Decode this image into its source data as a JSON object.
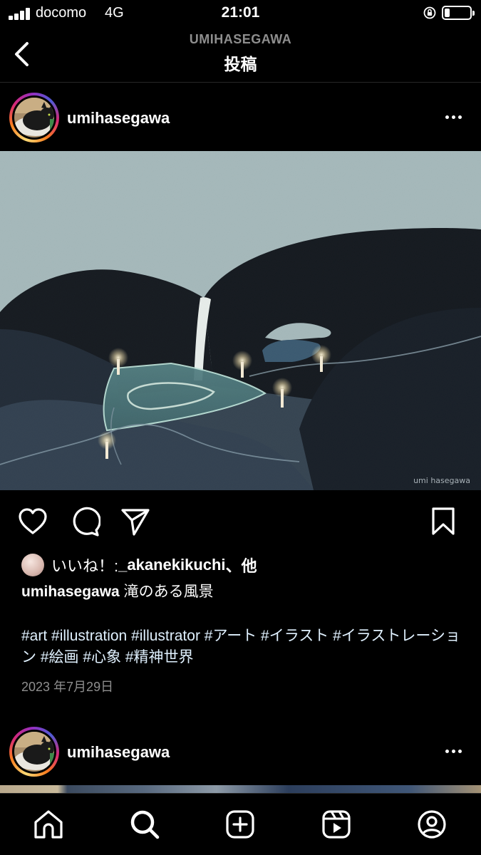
{
  "status_bar": {
    "carrier": "docomo",
    "network": "4G",
    "time": "21:01",
    "battery_level": 0.2
  },
  "header": {
    "subtitle": "UMIHASEGAWA",
    "title": "投稿"
  },
  "post": {
    "username": "umihasegawa",
    "image_watermark": "umi hasegawa",
    "likes_prefix": "いいね！: ",
    "likes_user": "_akanekikuchi",
    "likes_suffix": "、他",
    "caption_user": "umihasegawa",
    "caption_text": " 滝のある風景",
    "hashtags": "#art #illustration #illustrator #アート #イラスト #イラストレーション #絵画 #心象 #精神世界",
    "date": "2023 年7月29日"
  },
  "next_post": {
    "username": "umihasegawa"
  },
  "icons": {
    "back": "chevron-left-icon",
    "more": "more-horizontal-icon",
    "like": "heart-icon",
    "comment": "comment-bubble-icon",
    "share": "paper-plane-icon",
    "save": "bookmark-icon",
    "tabs": [
      "home-icon",
      "search-icon",
      "new-post-icon",
      "reels-icon",
      "profile-icon"
    ]
  },
  "colors": {
    "background": "#000000",
    "text": "#ffffff",
    "muted": "#8e8e8e",
    "hashtag": "#e0f1ff",
    "divider": "#262626"
  }
}
